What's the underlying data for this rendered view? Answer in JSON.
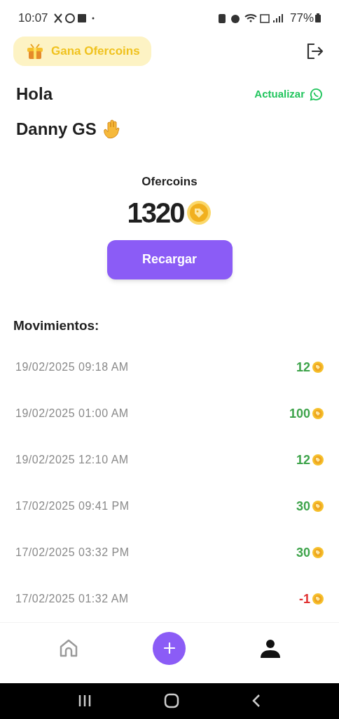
{
  "status_bar": {
    "time": "10:07",
    "battery": "77%"
  },
  "header": {
    "promo": "Gana Ofercoins"
  },
  "greeting": {
    "hello": "Hola",
    "update": "Actualizar",
    "name": "Danny GS"
  },
  "balance": {
    "label": "Ofercoins",
    "amount": "1320",
    "button": "Recargar"
  },
  "movements": {
    "title": "Movimientos:",
    "rows": [
      {
        "date": "19/02/2025 09:18 AM",
        "amount": "12",
        "kind": "credit"
      },
      {
        "date": "19/02/2025 01:00 AM",
        "amount": "100",
        "kind": "credit"
      },
      {
        "date": "19/02/2025 12:10 AM",
        "amount": "12",
        "kind": "credit"
      },
      {
        "date": "17/02/2025 09:41 PM",
        "amount": "30",
        "kind": "credit"
      },
      {
        "date": "17/02/2025 03:32 PM",
        "amount": "30",
        "kind": "credit"
      },
      {
        "date": "17/02/2025 01:32 AM",
        "amount": "-1",
        "kind": "debit"
      }
    ]
  },
  "bottom_nav": [
    {
      "kind": "home",
      "selected": false
    },
    {
      "kind": "add",
      "selected": false
    },
    {
      "kind": "profile",
      "selected": true
    }
  ]
}
